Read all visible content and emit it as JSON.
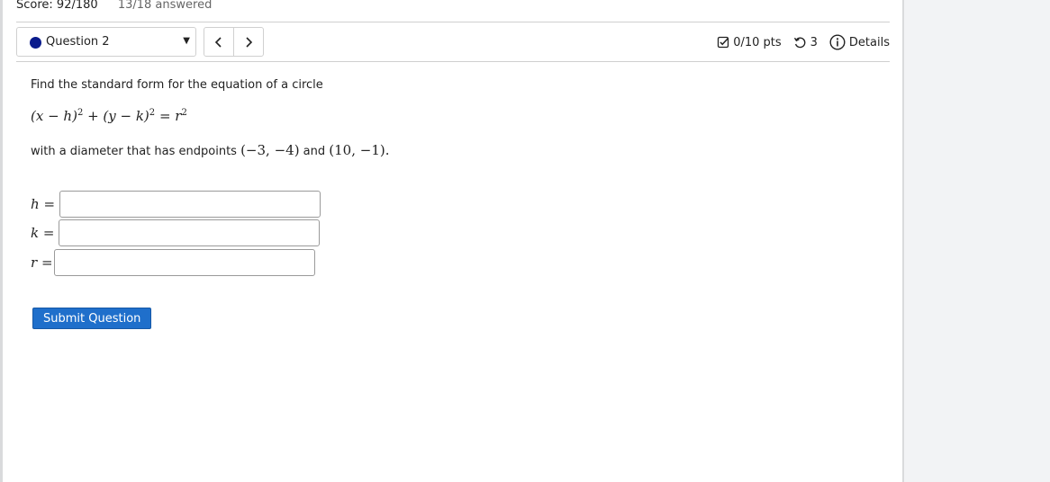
{
  "header": {
    "score_label": "Score: 92/180",
    "answered_label": "13/18 answered"
  },
  "question_nav": {
    "selected_question": "Question 2",
    "prev_icon": "chevron-left-icon",
    "next_icon": "chevron-right-icon",
    "status_color": "#0a1b8c"
  },
  "meta": {
    "points": "0/10 pts",
    "attempts": "3",
    "details_label": "Details"
  },
  "problem": {
    "prompt": "Find the standard form for the equation of a circle",
    "equation": {
      "part1": "(x − h)",
      "exp1": "2",
      "part2": " + (y − k)",
      "exp2": "2",
      "part3": " = r",
      "exp3": "2"
    },
    "diameter_text_before": "with a diameter that has endpoints ",
    "point1": "(−3, −4)",
    "and_text": " and ",
    "point2": "(10, −1)",
    "end_period": "."
  },
  "fields": [
    {
      "var": "h",
      "equals": " =",
      "value": ""
    },
    {
      "var": "k",
      "equals": " =",
      "value": ""
    },
    {
      "var": "r",
      "equals": " =",
      "value": ""
    }
  ],
  "submit_label": "Submit Question",
  "colors": {
    "submit_bg": "#1f6fcb",
    "page_bg": "#ffffff",
    "outer_bg": "#f2f3f5"
  }
}
